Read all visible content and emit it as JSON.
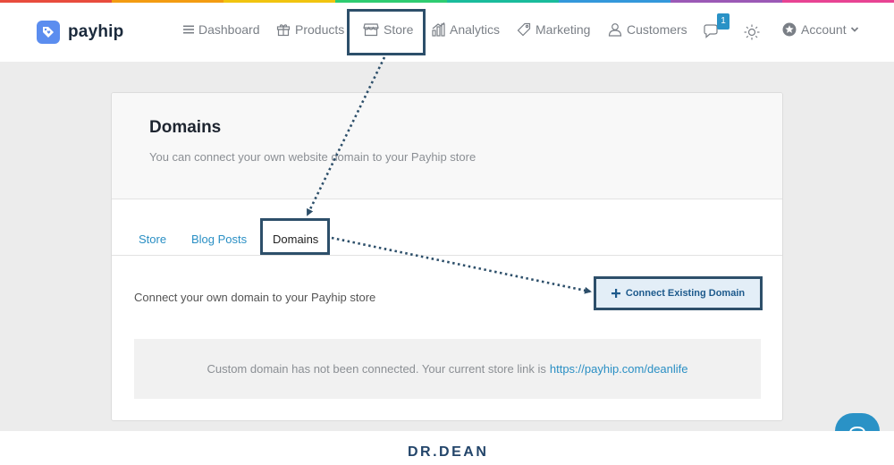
{
  "colors": {
    "accent": "#2a8fc4",
    "highlight_border": "#2d4f6a",
    "brand_blue": "#5b8def",
    "rainbow": [
      "#e84c3d",
      "#f39c12",
      "#f1c40f",
      "#2ecc71",
      "#1abc9c",
      "#3498db",
      "#9b59b6",
      "#e84393"
    ]
  },
  "brand": {
    "name": "payhip",
    "icon": "tag-heart-icon"
  },
  "nav": {
    "items": [
      {
        "label": "Dashboard",
        "icon": "menu-lines-icon"
      },
      {
        "label": "Products",
        "icon": "gift-icon"
      },
      {
        "label": "Store",
        "icon": "storefront-icon"
      },
      {
        "label": "Analytics",
        "icon": "bar-chart-icon"
      },
      {
        "label": "Marketing",
        "icon": "tag-icon"
      },
      {
        "label": "Customers",
        "icon": "person-icon"
      }
    ],
    "notifications_count": "1",
    "account_label": "Account"
  },
  "page": {
    "title": "Domains",
    "subtitle": "You can connect your own website domain to your Payhip store",
    "tabs": [
      {
        "label": "Store"
      },
      {
        "label": "Blog Posts"
      },
      {
        "label": "Domains",
        "active": true
      }
    ],
    "connect_text": "Connect your own domain to your Payhip store",
    "connect_button_label": "Connect Existing Domain",
    "info_text": "Custom domain has not been connected. Your current store link is",
    "store_link": "https://payhip.com/deanlife"
  },
  "footer": {
    "brand": "DR.DEAN"
  }
}
